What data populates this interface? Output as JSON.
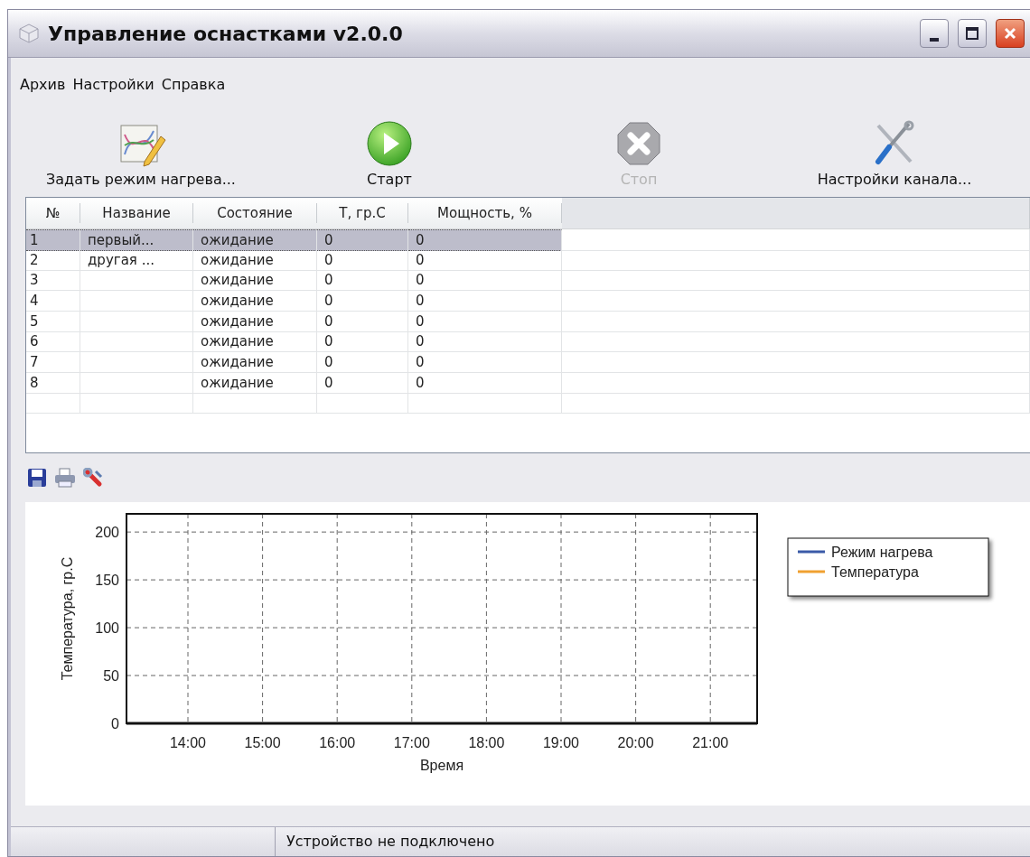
{
  "window": {
    "title": "Управление оснастками v2.0.0"
  },
  "menu": [
    "Архив",
    "Настройки",
    "Справка"
  ],
  "toolbar": [
    {
      "kind": "chart-edit",
      "label": "Задать режим нагрева...",
      "disabled": false
    },
    {
      "kind": "play",
      "label": "Старт",
      "disabled": false
    },
    {
      "kind": "stop",
      "label": "Стоп",
      "disabled": true
    },
    {
      "kind": "tools",
      "label": "Настройки канала...",
      "disabled": false
    }
  ],
  "table": {
    "columns": [
      "№",
      "Название",
      "Состояние",
      "T, гр.С",
      "Мощность, %"
    ],
    "rows": [
      {
        "no": "1",
        "name": "первый...",
        "status": "ожидание",
        "temp": "0",
        "power": "0",
        "selected": true
      },
      {
        "no": "2",
        "name": "другая ...",
        "status": "ожидание",
        "temp": "0",
        "power": "0",
        "selected": false
      },
      {
        "no": "3",
        "status": "ожидание",
        "temp": "0",
        "power": "0",
        "selected": false
      },
      {
        "no": "4",
        "status": "ожидание",
        "temp": "0",
        "power": "0",
        "selected": false
      },
      {
        "no": "5",
        "status": "ожидание",
        "temp": "0",
        "power": "0",
        "selected": false
      },
      {
        "no": "6",
        "status": "ожидание",
        "temp": "0",
        "power": "0",
        "selected": false
      },
      {
        "no": "7",
        "status": "ожидание",
        "temp": "0",
        "power": "0",
        "selected": false
      },
      {
        "no": "8",
        "status": "ожидание",
        "temp": "0",
        "power": "0",
        "selected": false
      }
    ]
  },
  "chart_toolbar": [
    {
      "kind": "save"
    },
    {
      "kind": "print"
    },
    {
      "kind": "wrench"
    }
  ],
  "chart": {
    "chart_data": {
      "type": "line",
      "xlabel": "Время",
      "ylabel": "Температура, гр.С",
      "categories": [
        "14:00",
        "15:00",
        "16:00",
        "17:00",
        "18:00",
        "19:00",
        "20:00",
        "21:00"
      ],
      "series": [
        {
          "name": "Режим нагрева",
          "color": "#3b5aa8",
          "values": [
            null,
            null,
            null,
            null,
            null,
            null,
            null,
            null
          ]
        },
        {
          "name": "Температура",
          "color": "#f0a030",
          "values": [
            null,
            null,
            null,
            null,
            null,
            null,
            null,
            null
          ]
        }
      ],
      "ylim": [
        0,
        219
      ],
      "grid": true,
      "yticks": [
        0,
        50,
        100,
        150,
        200
      ]
    }
  },
  "status_bar": {
    "text": "Устройство не подключено"
  }
}
